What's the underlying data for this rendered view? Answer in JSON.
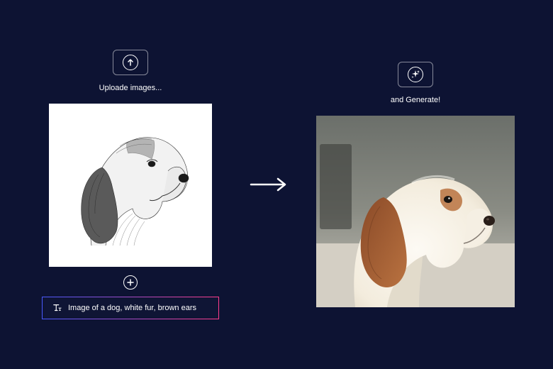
{
  "left": {
    "caption": "Uploade images...",
    "image_alt": "sketch-dog",
    "plus_icon": "plus-icon"
  },
  "prompt": {
    "text": "Image of a dog, white fur, brown ears",
    "icon": "text-type-icon"
  },
  "right": {
    "caption": "and Generate!",
    "image_alt": "generated-dog-photo"
  },
  "icons": {
    "upload": "upload-arrow-icon",
    "sparkle": "sparkle-icon",
    "arrow": "arrow-right-icon"
  }
}
